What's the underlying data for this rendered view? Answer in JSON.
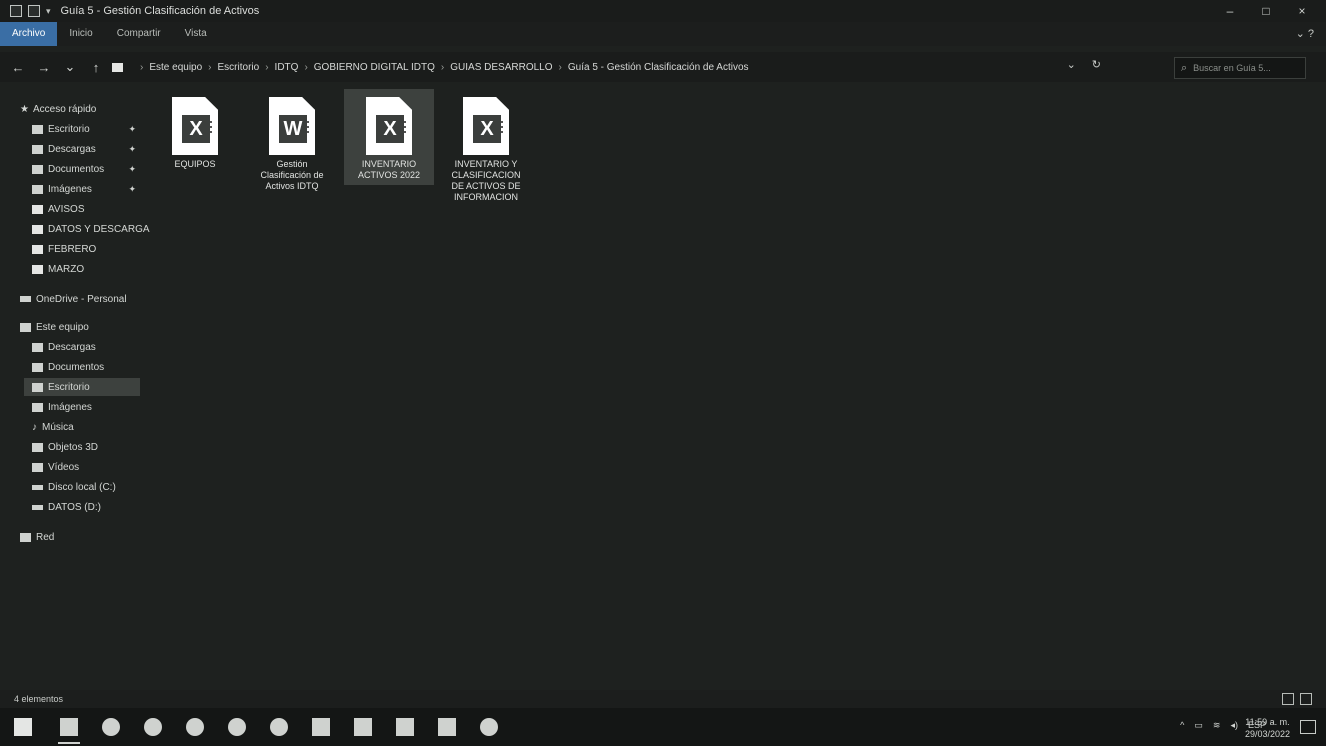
{
  "window": {
    "title": "Guía 5 - Gestión Clasificación de Activos",
    "controls": {
      "minimize": "–",
      "maximize": "□",
      "close": "×"
    }
  },
  "ribbon": {
    "tabs": [
      "Archivo",
      "Inicio",
      "Compartir",
      "Vista"
    ],
    "active_tab": "Archivo",
    "help": "⌄ ?"
  },
  "address": {
    "nav": {
      "back": "←",
      "forward": "→",
      "recent": "⌄",
      "up": "↑"
    },
    "crumbs": [
      "Este equipo",
      "Escritorio",
      "IDTQ",
      "GOBIERNO DIGITAL IDTQ",
      "GUIAS DESARROLLO",
      "Guía 5 - Gestión Clasificación de Activos"
    ],
    "dropdown": "⌄",
    "refresh": "↻",
    "search_placeholder": "Buscar en Guía 5..."
  },
  "sidebar": {
    "quick_access": "Acceso rápido",
    "quick_items": [
      {
        "label": "Escritorio",
        "pinned": true
      },
      {
        "label": "Descargas",
        "pinned": true
      },
      {
        "label": "Documentos",
        "pinned": true
      },
      {
        "label": "Imágenes",
        "pinned": true
      },
      {
        "label": "AVISOS",
        "pinned": false
      },
      {
        "label": "DATOS Y DESCARGA",
        "pinned": false
      },
      {
        "label": "FEBRERO",
        "pinned": false
      },
      {
        "label": "MARZO",
        "pinned": false
      }
    ],
    "onedrive": "OneDrive - Personal",
    "this_pc": "Este equipo",
    "pc_items": [
      "Descargas",
      "Documentos",
      "Escritorio",
      "Imágenes",
      "Música",
      "Objetos 3D",
      "Vídeos",
      "Disco local (C:)",
      "DATOS (D:)"
    ],
    "selected": "Escritorio",
    "network": "Red"
  },
  "files": [
    {
      "type": "excel",
      "badge": "X",
      "name": "EQUIPOS"
    },
    {
      "type": "word",
      "badge": "W",
      "name": "Gestión Clasificación de Activos IDTQ"
    },
    {
      "type": "excel",
      "badge": "X",
      "name": "INVENTARIO ACTIVOS 2022"
    },
    {
      "type": "excel",
      "badge": "X",
      "name": "INVENTARIO Y CLASIFICACION DE ACTIVOS DE INFORMACION"
    }
  ],
  "status": {
    "count": "4 elementos"
  },
  "taskbar": {
    "apps": [
      "start",
      "explorer",
      "chrome",
      "app-blue",
      "chat",
      "browser",
      "whatsapp",
      "app-doc",
      "app-store",
      "app-calc",
      "app-sheet",
      "app-leaf"
    ],
    "tray": {
      "chevron": "^",
      "lang": "ESP"
    },
    "clock": {
      "time": "11:59 a. m.",
      "date": "29/03/2022"
    }
  }
}
